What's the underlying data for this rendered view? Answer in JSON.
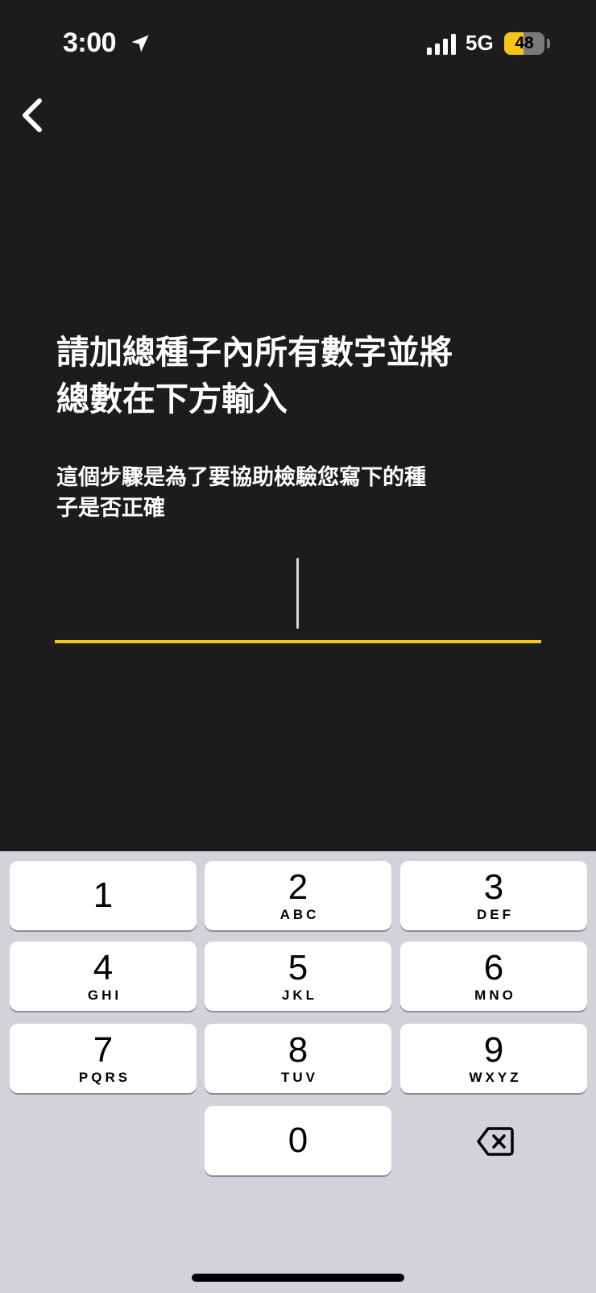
{
  "status_bar": {
    "time": "3:00",
    "network": "5G",
    "battery_level": "48",
    "battery_percent": 48,
    "icons": [
      "location-arrow-icon",
      "cellular-signal-icon",
      "battery-icon"
    ]
  },
  "nav": {
    "back_icon": "chevron-left-icon"
  },
  "content": {
    "heading_lines": [
      "請加總種子內所有數字並將",
      "總數在下方輸入"
    ],
    "subtitle_lines": [
      "這個步驟是為了要協助檢驗您寫下的種",
      "子是否正確"
    ],
    "input_value": "",
    "input_placeholder": ""
  },
  "keypad": {
    "keys": [
      {
        "digit": "1",
        "letters": ""
      },
      {
        "digit": "2",
        "letters": "ABC"
      },
      {
        "digit": "3",
        "letters": "DEF"
      },
      {
        "digit": "4",
        "letters": "GHI"
      },
      {
        "digit": "5",
        "letters": "JKL"
      },
      {
        "digit": "6",
        "letters": "MNO"
      },
      {
        "digit": "7",
        "letters": "PQRS"
      },
      {
        "digit": "8",
        "letters": "TUV"
      },
      {
        "digit": "9",
        "letters": "WXYZ"
      },
      {
        "digit": "0",
        "letters": ""
      }
    ],
    "delete_icon": "backspace-icon"
  },
  "colors": {
    "background": "#1c1c1c",
    "accent": "#f5c518",
    "keypad_background": "#d1d3d9",
    "key_background": "#ffffff"
  }
}
